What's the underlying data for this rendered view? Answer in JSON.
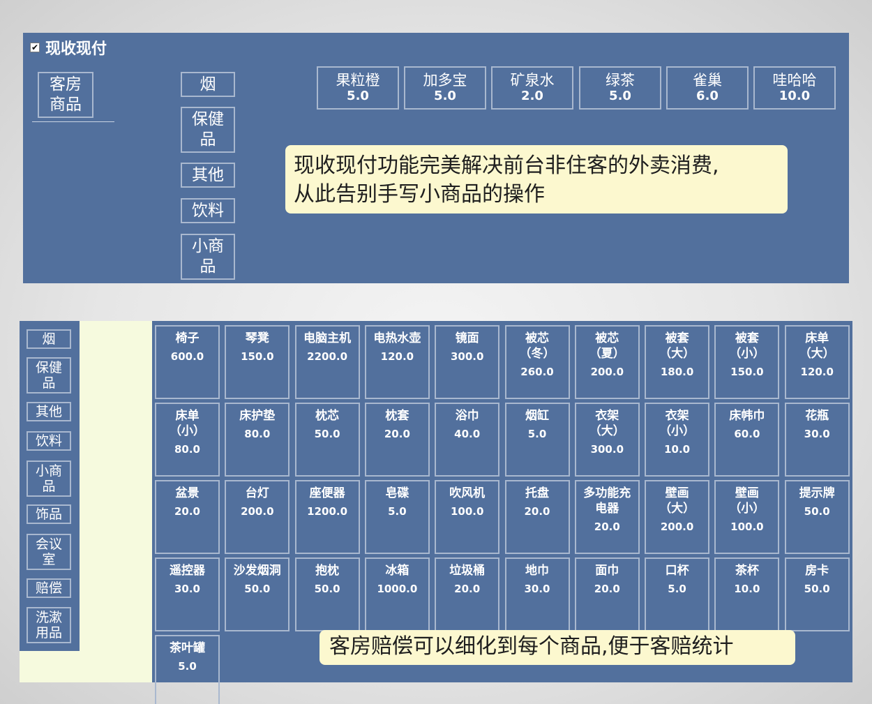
{
  "top": {
    "cash_label": "现收现付",
    "checkbox_mark": "✔",
    "categories": [
      {
        "lines": [
          "客房",
          "商品"
        ]
      },
      {
        "lines": [
          "烟"
        ]
      },
      {
        "lines": [
          "保健",
          "品"
        ]
      },
      {
        "lines": [
          "其他"
        ]
      },
      {
        "lines": [
          "饮料"
        ]
      },
      {
        "lines": [
          "小商",
          "品"
        ]
      }
    ],
    "products": [
      {
        "name": "果粒橙",
        "price": "5.0"
      },
      {
        "name": "加多宝",
        "price": "5.0"
      },
      {
        "name": "矿泉水",
        "price": "2.0"
      },
      {
        "name": "绿茶",
        "price": "5.0"
      },
      {
        "name": "雀巢",
        "price": "6.0"
      },
      {
        "name": "哇哈哈",
        "price": "10.0"
      }
    ],
    "callout": [
      "现收现付功能完美解决前台非住客的外卖消费,",
      "从此告别手写小商品的操作"
    ]
  },
  "bottom": {
    "categories": [
      {
        "lines": [
          "烟"
        ]
      },
      {
        "lines": [
          "保健",
          "品"
        ]
      },
      {
        "lines": [
          "其他"
        ]
      },
      {
        "lines": [
          "饮料"
        ]
      },
      {
        "lines": [
          "小商",
          "品"
        ]
      },
      {
        "lines": [
          "饰品"
        ]
      },
      {
        "lines": [
          "会议",
          "室"
        ]
      },
      {
        "lines": [
          "赔偿"
        ]
      },
      {
        "lines": [
          "洗漱",
          "用品"
        ]
      }
    ],
    "products": [
      {
        "lines": [
          "椅子"
        ],
        "price": "600.0"
      },
      {
        "lines": [
          "琴凳"
        ],
        "price": "150.0"
      },
      {
        "lines": [
          "电脑主机"
        ],
        "price": "2200.0"
      },
      {
        "lines": [
          "电热水壶"
        ],
        "price": "120.0"
      },
      {
        "lines": [
          "镜面"
        ],
        "price": "300.0"
      },
      {
        "lines": [
          "被芯",
          "（冬）"
        ],
        "price": "260.0"
      },
      {
        "lines": [
          "被芯",
          "（夏）"
        ],
        "price": "200.0"
      },
      {
        "lines": [
          "被套",
          "（大）"
        ],
        "price": "180.0"
      },
      {
        "lines": [
          "被套",
          "（小）"
        ],
        "price": "150.0"
      },
      {
        "lines": [
          "床单",
          "（大）"
        ],
        "price": "120.0"
      },
      {
        "lines": [
          "床单",
          "（小）"
        ],
        "price": "80.0"
      },
      {
        "lines": [
          "床护垫"
        ],
        "price": "80.0"
      },
      {
        "lines": [
          "枕芯"
        ],
        "price": "50.0"
      },
      {
        "lines": [
          "枕套"
        ],
        "price": "20.0"
      },
      {
        "lines": [
          "浴巾"
        ],
        "price": "40.0"
      },
      {
        "lines": [
          "烟缸"
        ],
        "price": "5.0"
      },
      {
        "lines": [
          "衣架",
          "（大）"
        ],
        "price": "300.0"
      },
      {
        "lines": [
          "衣架",
          "（小）"
        ],
        "price": "10.0"
      },
      {
        "lines": [
          "床帏巾"
        ],
        "price": "60.0"
      },
      {
        "lines": [
          "花瓶"
        ],
        "price": "30.0"
      },
      {
        "lines": [
          "盆景"
        ],
        "price": "20.0"
      },
      {
        "lines": [
          "台灯"
        ],
        "price": "200.0"
      },
      {
        "lines": [
          "座便器"
        ],
        "price": "1200.0"
      },
      {
        "lines": [
          "皂碟"
        ],
        "price": "5.0"
      },
      {
        "lines": [
          "吹风机"
        ],
        "price": "100.0"
      },
      {
        "lines": [
          "托盘"
        ],
        "price": "20.0"
      },
      {
        "lines": [
          "多功能充",
          "电器"
        ],
        "price": "20.0"
      },
      {
        "lines": [
          "壁画",
          "（大）"
        ],
        "price": "200.0"
      },
      {
        "lines": [
          "壁画",
          "（小）"
        ],
        "price": "100.0"
      },
      {
        "lines": [
          "提示牌"
        ],
        "price": "50.0"
      },
      {
        "lines": [
          "遥控器"
        ],
        "price": "30.0"
      },
      {
        "lines": [
          "沙发烟洞"
        ],
        "price": "50.0"
      },
      {
        "lines": [
          "抱枕"
        ],
        "price": "50.0"
      },
      {
        "lines": [
          "冰箱"
        ],
        "price": "1000.0"
      },
      {
        "lines": [
          "垃圾桶"
        ],
        "price": "20.0"
      },
      {
        "lines": [
          "地巾"
        ],
        "price": "30.0"
      },
      {
        "lines": [
          "面巾"
        ],
        "price": "20.0"
      },
      {
        "lines": [
          "口杯"
        ],
        "price": "5.0"
      },
      {
        "lines": [
          "茶杯"
        ],
        "price": "10.0"
      },
      {
        "lines": [
          "房卡"
        ],
        "price": "50.0"
      },
      {
        "lines": [
          "茶叶罐"
        ],
        "price": "5.0"
      }
    ],
    "callout": "客房赔偿可以细化到每个商品,便于客赔统计"
  },
  "colors": {
    "panel": "#52709d",
    "tile_border": "#a9b8cf",
    "callout_bg": "#fcf8cf",
    "side_bg": "#f6fade"
  }
}
